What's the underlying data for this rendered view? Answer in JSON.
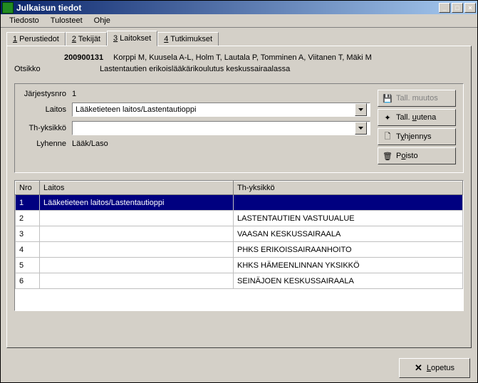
{
  "window": {
    "title": "Julkaisun tiedot"
  },
  "menu": {
    "tiedosto": "Tiedosto",
    "tulosteet": "Tulosteet",
    "ohje": "Ohje"
  },
  "tabs": {
    "t1": "1 Perustiedot",
    "t1u": "1",
    "t2": "2 Tekijät",
    "t2u": "2",
    "t3": "3 Laitokset",
    "t3u": "3",
    "t4": "4 Tutkimukset",
    "t4u": "4"
  },
  "header": {
    "id": "200900131",
    "authors": "Korppi M, Kuusela A-L, Holm T, Lautala P, Tomminen A, Viitanen T, Mäki M",
    "otsikko_label": "Otsikko",
    "otsikko_value": "Lastentautien erikoislääkärikoulutus keskussairaalassa"
  },
  "form": {
    "jarj_label": "Järjestysnro",
    "jarj_value": "1",
    "laitos_label": "Laitos",
    "laitos_value": "Lääketieteen laitos/Lastentautioppi",
    "thyk_label": "Th-yksikkö",
    "thyk_value": "",
    "lyh_label": "Lyhenne",
    "lyh_value": "Lääk/Laso"
  },
  "buttons": {
    "tall_muutos": "Tall. muutos",
    "tall_uutena": "Tall. uutena",
    "tyhjennys": "Tyhjennys",
    "poisto": "Poisto",
    "lopetus": "Lopetus"
  },
  "table": {
    "headers": {
      "nro": "Nro",
      "laitos": "Laitos",
      "thyk": "Th-yksikkö"
    },
    "rows": [
      {
        "nro": "1",
        "laitos": "Lääketieteen laitos/Lastentautioppi",
        "thyk": ""
      },
      {
        "nro": "2",
        "laitos": "",
        "thyk": "LASTENTAUTIEN VASTUUALUE"
      },
      {
        "nro": "3",
        "laitos": "",
        "thyk": "VAASAN KESKUSSAIRAALA"
      },
      {
        "nro": "4",
        "laitos": "",
        "thyk": "PHKS ERIKOISSAIRAANHOITO"
      },
      {
        "nro": "5",
        "laitos": "",
        "thyk": "KHKS HÄMEENLINNAN YKSIKKÖ"
      },
      {
        "nro": "6",
        "laitos": "",
        "thyk": "SEINÄJOEN KESKUSSAIRAALA"
      }
    ]
  }
}
